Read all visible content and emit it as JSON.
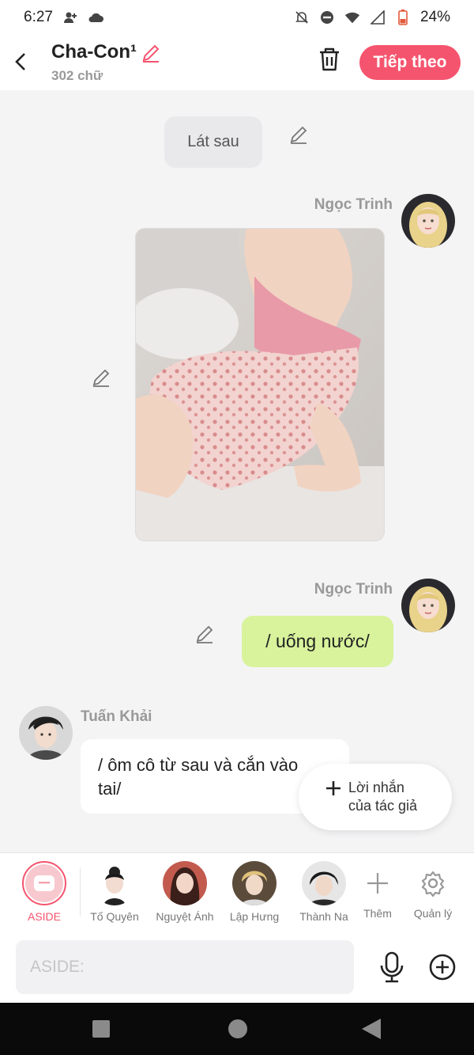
{
  "status_bar": {
    "time": "6:27",
    "battery": "24%"
  },
  "header": {
    "title": "Cha-Con¹",
    "word_count": "302 chữ",
    "next_label": "Tiếp theo"
  },
  "chat": {
    "system_bubble": "Lát sau",
    "messages": [
      {
        "sender": "Ngọc Trinh",
        "type": "image"
      },
      {
        "sender": "Ngọc Trinh",
        "text": "/ uống nước/"
      },
      {
        "sender": "Tuấn Khải",
        "line1": "/ ôm cô từ sau và cắn vào",
        "line2": "tai/"
      }
    ]
  },
  "author_note": {
    "line1": "Lời nhắn",
    "line2": "của tác giả"
  },
  "characters": [
    {
      "label": "ASIDE"
    },
    {
      "label": "Tố Quyên"
    },
    {
      "label": "Nguyệt Ánh"
    },
    {
      "label": "Lập Hưng"
    },
    {
      "label": "Thành Na"
    },
    {
      "label": "Thêm"
    },
    {
      "label": "Quản lý"
    }
  ],
  "input": {
    "placeholder": "ASIDE:"
  },
  "colors": {
    "accent": "#f5546e",
    "green_bubble": "#d8f39c",
    "background": "#f4f4f5"
  }
}
